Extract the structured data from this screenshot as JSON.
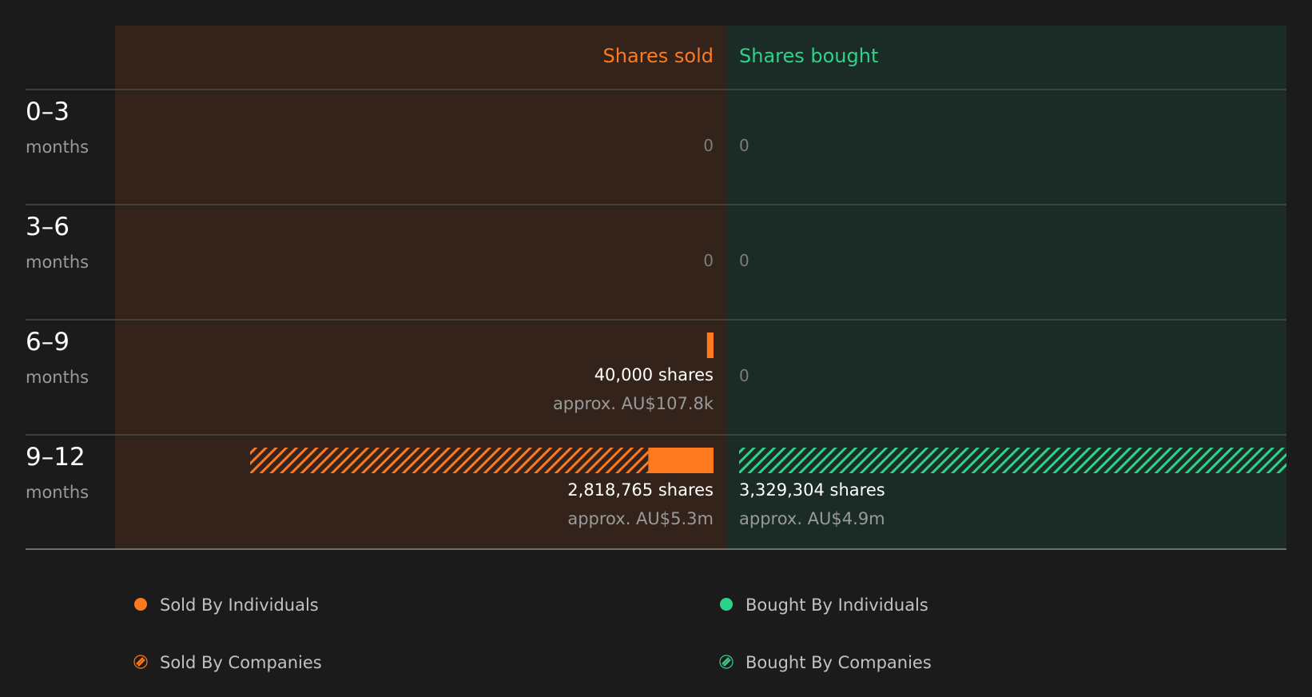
{
  "chart_data": {
    "type": "bar",
    "columns": {
      "sold": "Shares sold",
      "bought": "Shares bought"
    },
    "unit_label": "months",
    "rows": [
      {
        "period": "0–3",
        "sold": {
          "individuals": 0,
          "companies": 0,
          "label": "0",
          "approx": ""
        },
        "bought": {
          "individuals": 0,
          "companies": 0,
          "label": "0",
          "approx": ""
        }
      },
      {
        "period": "3–6",
        "sold": {
          "individuals": 0,
          "companies": 0,
          "label": "0",
          "approx": ""
        },
        "bought": {
          "individuals": 0,
          "companies": 0,
          "label": "0",
          "approx": ""
        }
      },
      {
        "period": "6–9",
        "sold": {
          "individuals": 40000,
          "companies": 0,
          "label": "40,000 shares",
          "approx": "approx. AU$107.8k"
        },
        "bought": {
          "individuals": 0,
          "companies": 0,
          "label": "0",
          "approx": ""
        }
      },
      {
        "period": "9–12",
        "sold": {
          "individuals": 397000,
          "companies": 2421765,
          "label": "2,818,765 shares",
          "approx": "approx. AU$5.3m"
        },
        "bought": {
          "individuals": 0,
          "companies": 3329304,
          "label": "3,329,304 shares",
          "approx": "approx. AU$4.9m"
        }
      }
    ],
    "max_value": 3329304,
    "legend": [
      {
        "label": "Sold By Individuals",
        "side": "sold",
        "pattern": "solid"
      },
      {
        "label": "Bought By Individuals",
        "side": "bought",
        "pattern": "solid"
      },
      {
        "label": "Sold By Companies",
        "side": "sold",
        "pattern": "hatched"
      },
      {
        "label": "Bought By Companies",
        "side": "bought",
        "pattern": "hatched"
      }
    ],
    "colors": {
      "sold": "#ff7a1e",
      "bought": "#2ed38a",
      "sold_panel": "#33231b",
      "bought_panel": "#1b2b25",
      "background": "#1b1b1b"
    }
  }
}
